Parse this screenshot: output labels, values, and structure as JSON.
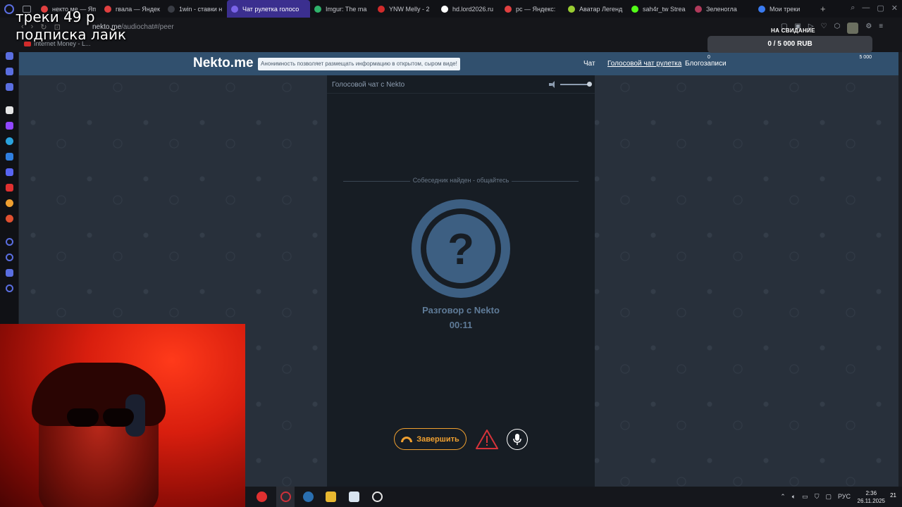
{
  "browser": {
    "tabs": [
      {
        "label": "некто ме — Яп",
        "color": "#e04040"
      },
      {
        "label": "гвала — Яндек",
        "color": "#e04040"
      },
      {
        "label": "1win - ставки н",
        "color": "#3a3d45"
      },
      {
        "label": "Чат рулетка голосо",
        "color": "#7a64e8",
        "active": true
      },
      {
        "label": "Imgur: The ma",
        "color": "#2fb36b"
      },
      {
        "label": "YNW Melly - 2",
        "color": "#d12b2b"
      },
      {
        "label": "hd.lord2026.ru",
        "color": "#ffffff"
      },
      {
        "label": "рс — Яндекс: ",
        "color": "#e04040"
      },
      {
        "label": "Аватар Легенд",
        "color": "#9acd32"
      },
      {
        "label": "sah4r_tw Strea",
        "color": "#53fc18"
      },
      {
        "label": "Зеленогла",
        "color": "#b03a5b"
      },
      {
        "label": "Мои треки",
        "color": "#3a7bf0"
      }
    ],
    "url_host": "nekto.me",
    "url_path": "/audiochat#/peer",
    "bookmark": "Internet Money - L..."
  },
  "overlay": {
    "line1": "треки 49 р",
    "line2": "подписка лайк"
  },
  "donation": {
    "title": "НА СВИДАНИЕ",
    "amount": "0 / 5 000 RUB",
    "min": "0",
    "max": "5 000",
    "progress": 0
  },
  "site": {
    "logo": "Nekto.me",
    "tagline": "Анонимность позволяет размещать информацию в открытом, сырoм виде!",
    "nav": [
      {
        "label": "Чат"
      },
      {
        "label": "Голосовой чат рулетка",
        "active": true
      },
      {
        "label": "Блогозаписи"
      }
    ]
  },
  "chat": {
    "title": "Голосовой чат с Nekto",
    "status": "Собеседник найден - общайтесь",
    "peer_name": "Разговор с Nekto",
    "timer": "00:11",
    "avatar_glyph": "?",
    "end_label": "Завершить",
    "volume": 1
  },
  "taskbar": {
    "language": "РУС",
    "time": "2:36",
    "date": "26.11.2025",
    "notifications": "21"
  },
  "colors": {
    "accent": "#f0a030",
    "header": "#31506e",
    "avatar": "#3d5f82",
    "report": "#d6333a"
  }
}
